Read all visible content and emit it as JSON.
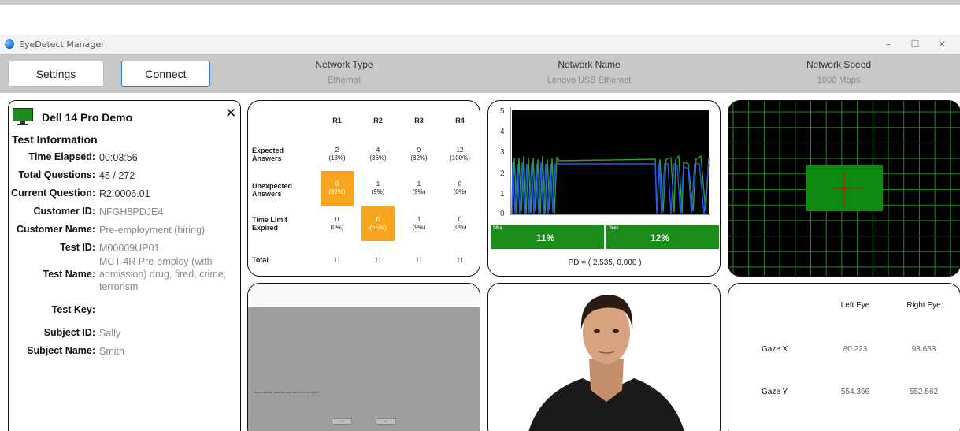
{
  "window": {
    "title": "EyeDetect Manager",
    "minimize": "–",
    "maximize": "☐",
    "close": "✕"
  },
  "toolbar": {
    "settings_label": "Settings",
    "connect_label": "Connect",
    "network_type_label": "Network Type",
    "network_type_value": "Ethernet",
    "network_name_label": "Network Name",
    "network_name_value": "Lenovo USB Ethernet",
    "network_speed_label": "Network Speed",
    "network_speed_value": "1000 Mbps"
  },
  "device": {
    "name": "Dell 14 Pro Demo",
    "close": "✕",
    "icon": "monitor-icon",
    "icon_color": "#1e8a1e"
  },
  "test_info": {
    "section_title": "Test Information",
    "rows": [
      {
        "label": "Time Elapsed:",
        "value": "00:03:56"
      },
      {
        "label": "Total Questions:",
        "value": "45 / 272"
      },
      {
        "label": "Current Question:",
        "value": "R2.0006.01"
      },
      {
        "label": "Customer ID:",
        "value": "NFGH8PDJE4"
      },
      {
        "label": "Customer Name:",
        "value": "Pre-employment (hiring)"
      },
      {
        "label": "Test ID:",
        "value": "M00009UP01"
      },
      {
        "label": "Test Name:",
        "value": "MCT 4R Pre-employ (with admission) drug, fired, crime, terrorism"
      },
      {
        "label": "Test Key:",
        "value": ""
      },
      {
        "label": "Subject ID:",
        "value": "Sally"
      },
      {
        "label": "Subject Name:",
        "value": "Smith"
      }
    ]
  },
  "answers_table": {
    "columns": [
      "R1",
      "R2",
      "R3",
      "R4"
    ],
    "rows": [
      {
        "label": [
          "Expected",
          "Answers"
        ],
        "cells": [
          [
            "2",
            "(18%)"
          ],
          [
            "4",
            "(36%)"
          ],
          [
            "9",
            "(82%)"
          ],
          [
            "12",
            "(100%)"
          ]
        ]
      },
      {
        "label": [
          "Unexpected",
          "Answers"
        ],
        "cells": [
          [
            "9",
            "(82%)"
          ],
          [
            "1",
            "(9%)"
          ],
          [
            "1",
            "(9%)"
          ],
          [
            "0",
            "(0%)"
          ]
        ]
      },
      {
        "label": [
          "Time Limit",
          "Expired"
        ],
        "cells": [
          [
            "0",
            "(0%)"
          ],
          [
            "6",
            "(55%)"
          ],
          [
            "1",
            "(9%)"
          ],
          [
            "0",
            "(0%)"
          ]
        ]
      }
    ],
    "total_label": "Total",
    "totals": [
      "11",
      "11",
      "11",
      "11"
    ],
    "highlight_color": "#f7a51e"
  },
  "pupil_chart": {
    "y_ticks": [
      "5",
      "4",
      "3",
      "2",
      "1",
      "0"
    ],
    "box1_small": "30 s",
    "box1_value": "11%",
    "box2_small": "Test",
    "box2_value": "12%",
    "pd_label": "PD = ( 2.535, 0.000 )",
    "series_colors": [
      "#2f9e2f",
      "#2255ff"
    ]
  },
  "gaze_grid": {
    "grid_color": "#1e8a1e",
    "target_color": "#0e8a0e",
    "crosshair_color": "#cc1111"
  },
  "screen_preview": {
    "top_text": "———",
    "question_text": "In your lifetime, have you ever been fired from a job?",
    "button_yes": "Yes",
    "button_no": "No"
  },
  "gaze_table": {
    "left_eye_label": "Left Eye",
    "right_eye_label": "Right Eye",
    "rows": [
      {
        "label": "Gaze X",
        "left": "80.223",
        "right": "93.653"
      },
      {
        "label": "Gaze Y",
        "left": "554.366",
        "right": "552.562"
      }
    ]
  }
}
